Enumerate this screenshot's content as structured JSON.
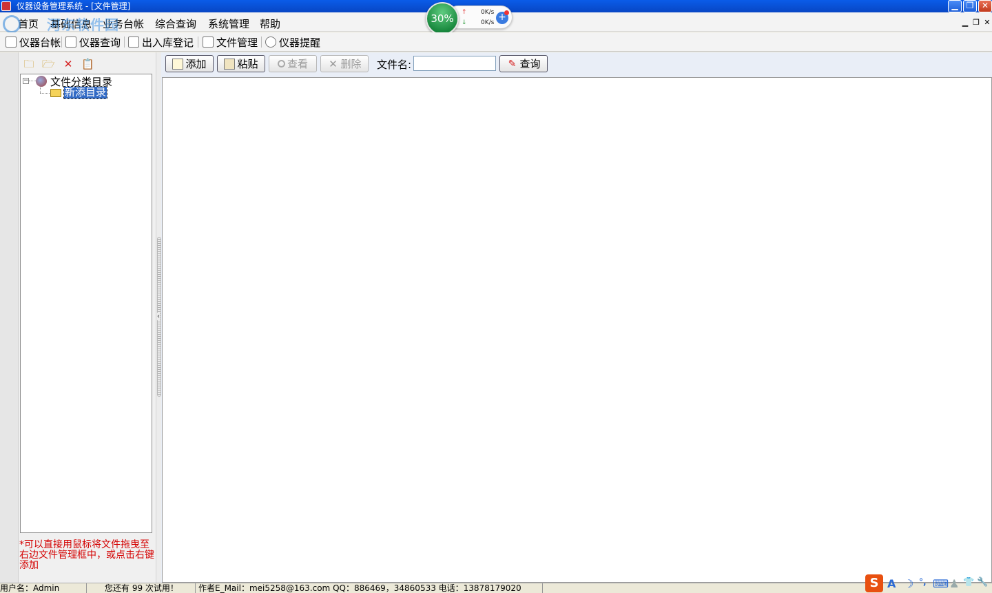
{
  "window": {
    "title": "仪器设备管理系统 - [文件管理]",
    "min": "▁",
    "max": "❐",
    "close": "✕"
  },
  "menu": [
    "首页",
    "基础信息",
    "业务台帐",
    "综合查询",
    "系统管理",
    "帮助"
  ],
  "mdi_controls": [
    "▁",
    "❐",
    "✕"
  ],
  "watermark": {
    "text": "河东软件园",
    "url": "www.pc0359.cn"
  },
  "netmon": {
    "percent": "30%",
    "up_rate": "0K/s",
    "down_rate": "0K/s",
    "up_arrow": "↑",
    "down_arrow": "↓",
    "plus": "+"
  },
  "toolbar": [
    "仪器台帐",
    "仪器查询",
    "出入库登记",
    "文件管理",
    "仪器提醒"
  ],
  "left_tools": {
    "new_folder": "🗀",
    "open_folder": "🗁",
    "delete": "✕",
    "paste": "📋"
  },
  "tree": {
    "root": "文件分类目录",
    "child": "新添目录",
    "expander": "−"
  },
  "hint": "*可以直接用鼠标将文件拖曳至右边文件管理框中，或点击右键添加",
  "actions": {
    "add": "添加",
    "paste": "粘贴",
    "view": "查看",
    "delete": "删除",
    "filename_label": "文件名:",
    "filename_value": "",
    "search": "查询"
  },
  "splitter_arrow": "‹",
  "status": {
    "user": "用户名：Admin",
    "trial": "您还有 99 次试用！",
    "contact": "作者E_Mail：mei5258@163.com    QQ：886469，34860533    电话：13878179020"
  },
  "ime": {
    "logo": "S",
    "glyphs": [
      "A",
      "☽",
      "°,",
      "⌨",
      "♟",
      "👕",
      "🔧"
    ]
  }
}
